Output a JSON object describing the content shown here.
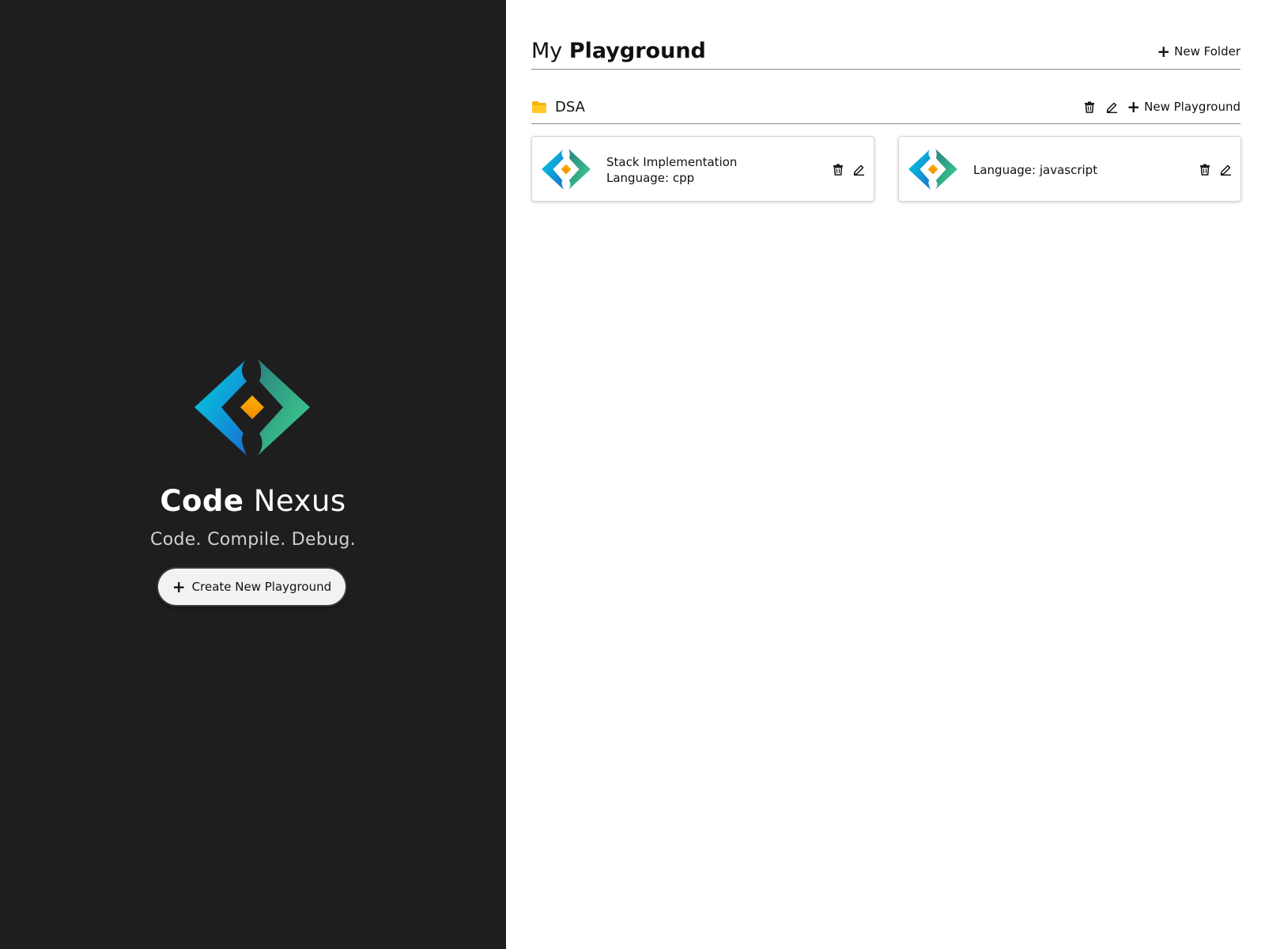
{
  "brand": {
    "title_bold": "Code",
    "title_light": "Nexus",
    "tagline": "Code. Compile. Debug.",
    "logo_icon": "code-nexus-logo-icon",
    "colors": {
      "cyan": "#00c2d9",
      "blue": "#1f7fd6",
      "teal": "#2a8f86",
      "green": "#3fcf8e",
      "diamond": "#f7a800",
      "panel": "#1e1e1e"
    }
  },
  "sidebar": {
    "create_button_label": "Create New Playground"
  },
  "main": {
    "title_light": "My",
    "title_bold": "Playground",
    "new_folder_label": "New Folder",
    "folders": [
      {
        "name": "DSA",
        "new_playground_label": "New Playground",
        "playgrounds": [
          {
            "title": "Stack Implementation",
            "language": "Language: cpp"
          },
          {
            "title": "",
            "language": "Language: javascript"
          }
        ]
      }
    ]
  }
}
